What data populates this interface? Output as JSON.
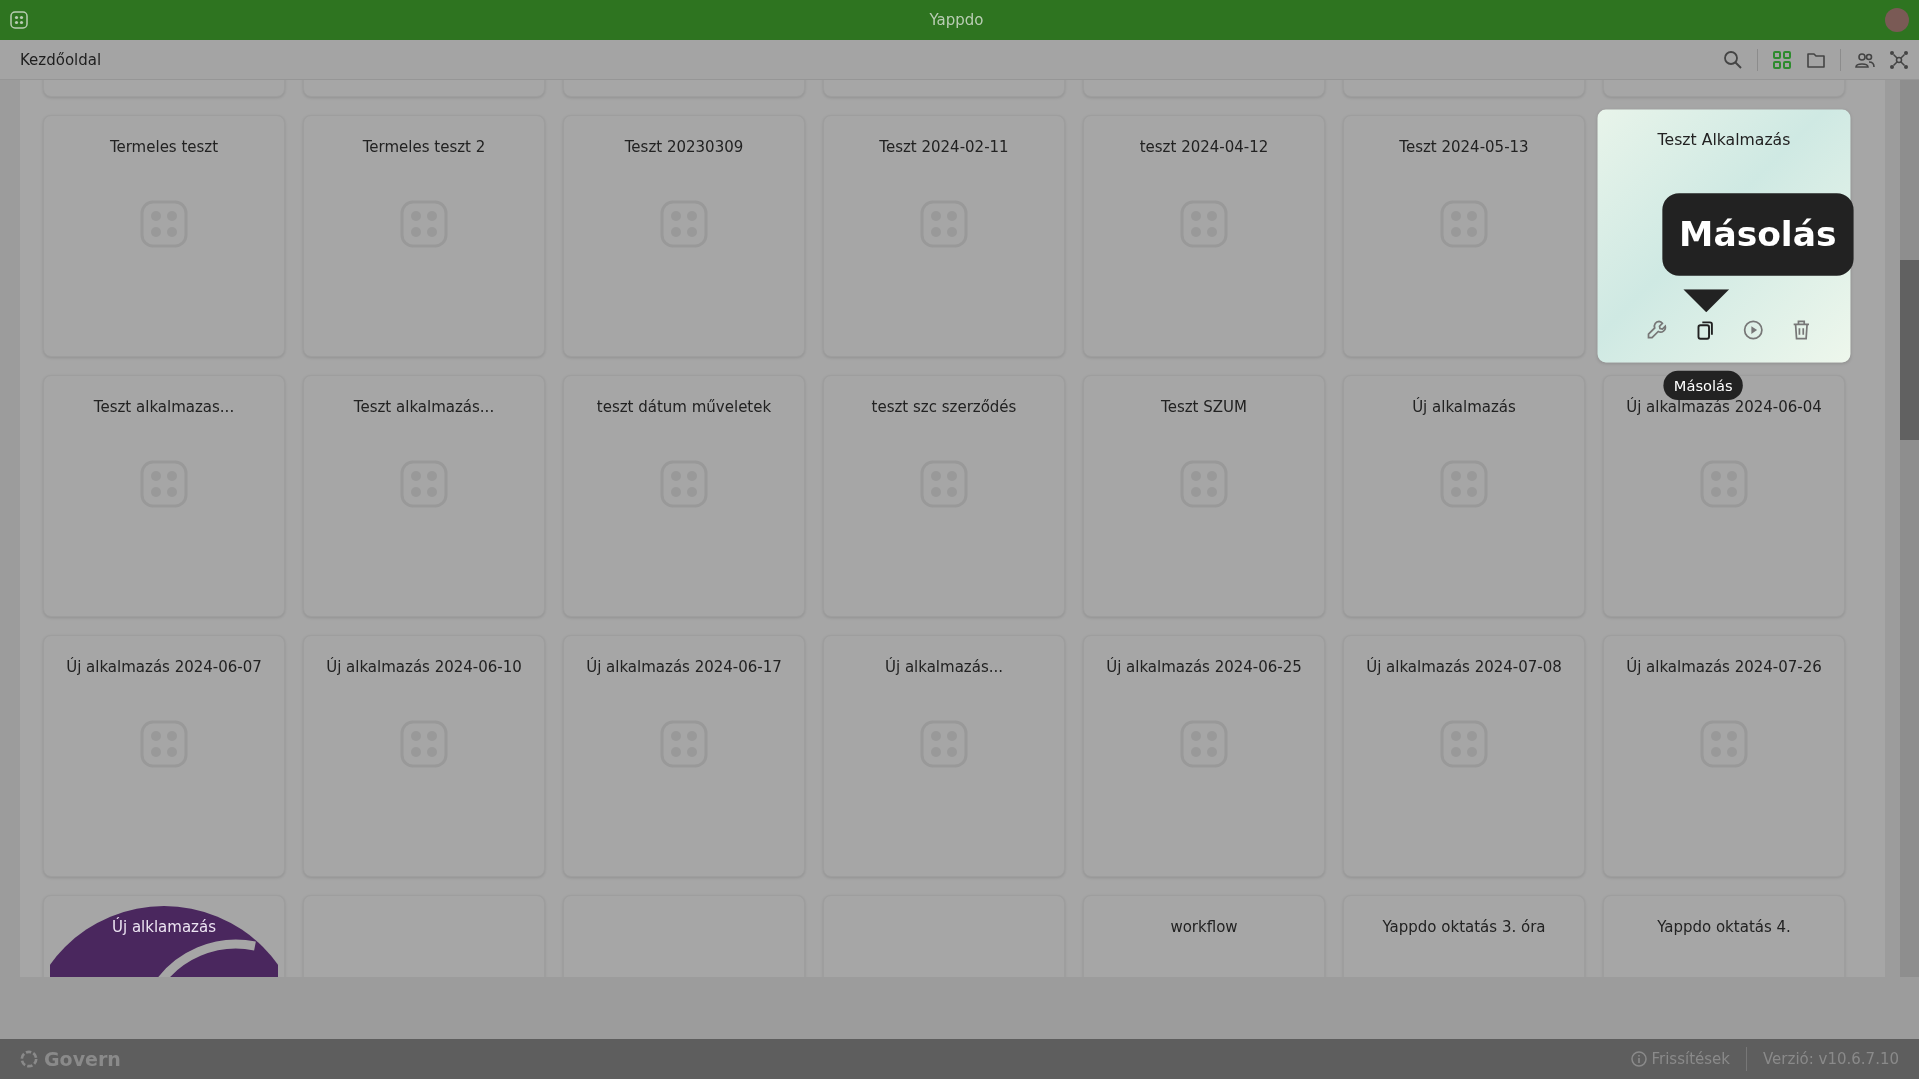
{
  "window": {
    "title": "Yappdo"
  },
  "toolbar": {
    "breadcrumb": "Kezdőoldal",
    "views": [
      {
        "kind": "grid",
        "selected": true
      },
      {
        "kind": "folder",
        "selected": false
      }
    ]
  },
  "apps": [
    {
      "kind": "blank"
    },
    {
      "kind": "blank"
    },
    {
      "kind": "blank"
    },
    {
      "kind": "blank"
    },
    {
      "kind": "blank"
    },
    {
      "kind": "blank"
    },
    {
      "kind": "blank"
    },
    {
      "kind": "plain",
      "title": "Termeles teszt"
    },
    {
      "kind": "plain",
      "title": "Termeles teszt 2"
    },
    {
      "kind": "plain",
      "title": "Teszt 20230309"
    },
    {
      "kind": "plain",
      "title": "Teszt 2024-02-11"
    },
    {
      "kind": "plain",
      "title": "teszt 2024-04-12"
    },
    {
      "kind": "plain",
      "title": "Teszt 2024-05-13"
    },
    {
      "kind": "hovered",
      "title": "Teszt Alkalmazás",
      "tooltip": "Másolás",
      "hint": "Másolás"
    },
    {
      "kind": "plain",
      "title": "Teszt alkalmazas..."
    },
    {
      "kind": "plain",
      "title": "Teszt alkalmazás..."
    },
    {
      "kind": "plain",
      "title": "teszt dátum műveletek"
    },
    {
      "kind": "plain",
      "title": "teszt szc szerződés"
    },
    {
      "kind": "plain",
      "title": "Teszt SZUM"
    },
    {
      "kind": "plain",
      "title": "Új alkalmazás"
    },
    {
      "kind": "plain",
      "title": "Új alkalmazás 2024-06-04"
    },
    {
      "kind": "plain",
      "title": "Új alkalmazás 2024-06-07"
    },
    {
      "kind": "plain",
      "title": "Új alkalmazás 2024-06-10"
    },
    {
      "kind": "plain",
      "title": "Új alkalmazás 2024-06-17"
    },
    {
      "kind": "plain",
      "title": "Új alkalmazás..."
    },
    {
      "kind": "plain",
      "title": "Új alkalmazás 2024-06-25"
    },
    {
      "kind": "plain",
      "title": "Új alkalmazás 2024-07-08"
    },
    {
      "kind": "plain",
      "title": "Új alkalmazás 2024-07-26"
    },
    {
      "kind": "logo",
      "title": "Új alklamazás"
    },
    {
      "kind": "blank"
    },
    {
      "kind": "blank"
    },
    {
      "kind": "blank"
    },
    {
      "kind": "plain",
      "title": "workflow"
    },
    {
      "kind": "plain",
      "title": "Yappdo oktatás 3. óra"
    },
    {
      "kind": "plain",
      "title": "Yappdo oktatás 4."
    }
  ],
  "footer": {
    "brand": "Govern",
    "updates": "Frissítések",
    "version": "Verzió: v10.6.7.10"
  }
}
